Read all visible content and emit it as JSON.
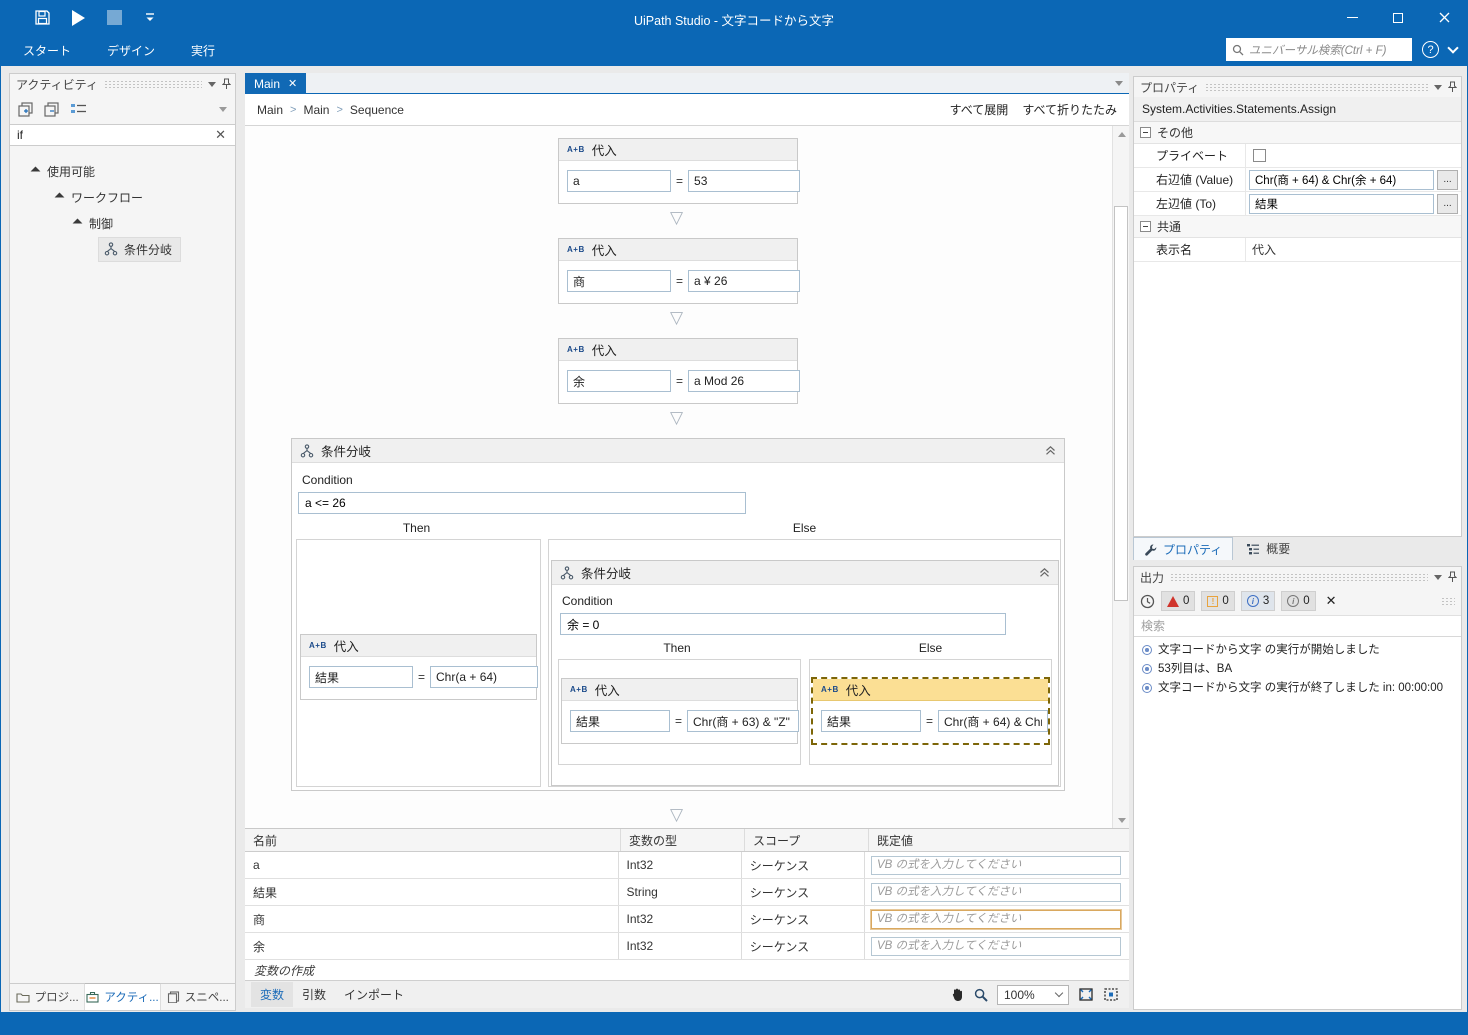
{
  "colors": {
    "accent": "#0b67b5",
    "selection_fill": "#fbdf94",
    "selection_border": "#7d6608",
    "error": "#d0342c",
    "warning": "#e8a33d",
    "info": "#3d6fc4"
  },
  "titlebar": {
    "title": "UiPath Studio - 文字コードから文字",
    "help_glyph": "?",
    "menu_tabs": [
      "スタート",
      "デザイン",
      "実行"
    ],
    "search_placeholder": "ユニバーサル検索(Ctrl + F)"
  },
  "activities_panel": {
    "title": "アクティビティ",
    "search_value": "if",
    "clear_glyph": "✕",
    "tree": {
      "level1": "使用可能",
      "level2": "ワークフロー",
      "level3": "制御",
      "leaf": "条件分岐"
    },
    "bottom_tabs": [
      "プロジ...",
      "アクティ...",
      "スニペ..."
    ]
  },
  "designer": {
    "tab_label": "Main",
    "tab_close_glyph": "✕",
    "breadcrumb": [
      "Main",
      "Main",
      "Sequence"
    ],
    "breadcrumb_separator": ">",
    "expand_all": "すべて展開",
    "collapse_all": "すべて折りたたみ",
    "equals": "=",
    "flow_arrow_glyph": "▽",
    "assign_icon_glyph": "A+B",
    "assigns": [
      {
        "title": "代入",
        "to": "a",
        "value": "53"
      },
      {
        "title": "代入",
        "to": "商",
        "value": "a ¥ 26"
      },
      {
        "title": "代入",
        "to": "余",
        "value": "a Mod 26"
      }
    ],
    "outer_if": {
      "title": "条件分岐",
      "condition_label": "Condition",
      "condition": "a <= 26",
      "then_label": "Then",
      "else_label": "Else",
      "then_assign": {
        "title": "代入",
        "to": "結果",
        "value": "Chr(a + 64)"
      },
      "inner_if": {
        "title": "条件分岐",
        "condition_label": "Condition",
        "condition": "余 = 0",
        "then_label": "Then",
        "else_label": "Else",
        "then_assign": {
          "title": "代入",
          "to": "結果",
          "value": "Chr(商 + 63) & \"Z\""
        },
        "else_assign": {
          "title": "代入",
          "to": "結果",
          "value": "Chr(商 + 64) & Chr"
        }
      }
    }
  },
  "variables": {
    "headers": [
      "名前",
      "変数の型",
      "スコープ",
      "既定値"
    ],
    "default_placeholder": "VB の式を入力してください",
    "rows": [
      {
        "name": "a",
        "type": "Int32",
        "scope": "シーケンス"
      },
      {
        "name": "結果",
        "type": "String",
        "scope": "シーケンス"
      },
      {
        "name": "商",
        "type": "Int32",
        "scope": "シーケンス"
      },
      {
        "name": "余",
        "type": "Int32",
        "scope": "シーケンス"
      }
    ],
    "create_label": "変数の作成",
    "tabs": [
      "変数",
      "引数",
      "インポート"
    ],
    "zoom_value": "100%"
  },
  "properties": {
    "title": "プロパティ",
    "class_name": "System.Activities.Statements.Assign",
    "group_other": "その他",
    "group_common": "共通",
    "rows": {
      "private_label": "プライベート",
      "value_label": "右辺値 (Value)",
      "value_value": "Chr(商 + 64) & Chr(余 + 64)",
      "to_label": "左辺値 (To)",
      "to_value": "結果",
      "display_label": "表示名",
      "display_value": "代入"
    },
    "dots_glyph": "...",
    "tabs": [
      "プロパティ",
      "概要"
    ]
  },
  "output": {
    "title": "出力",
    "badges": {
      "error": "0",
      "warning": "0",
      "info": "3",
      "trace": "0"
    },
    "clear_glyph": "✕",
    "search_placeholder": "検索",
    "messages": [
      "文字コードから文字 の実行が開始しました",
      "53列目は、BA",
      "文字コードから文字 の実行が終了しました in: 00:00:00"
    ]
  }
}
